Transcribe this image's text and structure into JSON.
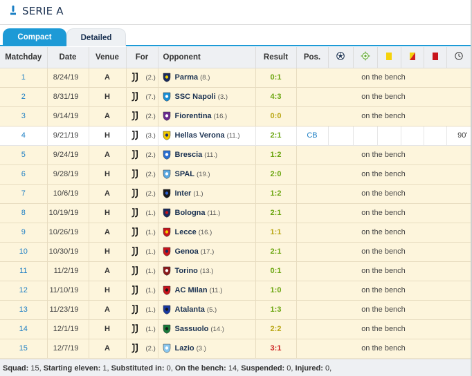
{
  "competition": {
    "title": "SERIE A",
    "icon": "serie-a-icon"
  },
  "tabs": [
    {
      "label": "Compact",
      "active": true
    },
    {
      "label": "Detailed",
      "active": false
    }
  ],
  "columns": {
    "matchday": "Matchday",
    "date": "Date",
    "venue": "Venue",
    "for": "For",
    "opponent": "Opponent",
    "result": "Result",
    "pos": "Pos.",
    "icons": [
      "goals-icon",
      "assists-icon",
      "yellow-card-icon",
      "yellow-red-card-icon",
      "red-card-icon",
      "minutes-clock-icon"
    ]
  },
  "colors": {
    "accent": "#1d9ad6",
    "win": "#6aa50f",
    "draw": "#b9a613",
    "loss": "#cc1e1e",
    "bench_row": "#fdf5dc"
  },
  "rows": [
    {
      "md": "1",
      "date": "8/24/19",
      "venue": "A",
      "for_rank": "(2.)",
      "opp": "Parma",
      "opp_rank": "(8.)",
      "result": "0:1",
      "outcome": "win",
      "status": "on the bench",
      "logo": "parma-logo"
    },
    {
      "md": "2",
      "date": "8/31/19",
      "venue": "H",
      "for_rank": "(7.)",
      "opp": "SSC Napoli",
      "opp_rank": "(3.)",
      "result": "4:3",
      "outcome": "win",
      "status": "on the bench",
      "logo": "napoli-logo"
    },
    {
      "md": "3",
      "date": "9/14/19",
      "venue": "A",
      "for_rank": "(2.)",
      "opp": "Fiorentina",
      "opp_rank": "(16.)",
      "result": "0:0",
      "outcome": "draw",
      "status": "on the bench",
      "logo": "fiorentina-logo"
    },
    {
      "md": "4",
      "date": "9/21/19",
      "venue": "H",
      "for_rank": "(3.)",
      "opp": "Hellas Verona",
      "opp_rank": "(11.)",
      "result": "2:1",
      "outcome": "win",
      "pos": "CB",
      "minutes": "90'",
      "logo": "verona-logo"
    },
    {
      "md": "5",
      "date": "9/24/19",
      "venue": "A",
      "for_rank": "(2.)",
      "opp": "Brescia",
      "opp_rank": "(11.)",
      "result": "1:2",
      "outcome": "win",
      "status": "on the bench",
      "logo": "brescia-logo"
    },
    {
      "md": "6",
      "date": "9/28/19",
      "venue": "H",
      "for_rank": "(2.)",
      "opp": "SPAL",
      "opp_rank": "(19.)",
      "result": "2:0",
      "outcome": "win",
      "status": "on the bench",
      "logo": "spal-logo"
    },
    {
      "md": "7",
      "date": "10/6/19",
      "venue": "A",
      "for_rank": "(2.)",
      "opp": "Inter",
      "opp_rank": "(1.)",
      "result": "1:2",
      "outcome": "win",
      "status": "on the bench",
      "logo": "inter-logo"
    },
    {
      "md": "8",
      "date": "10/19/19",
      "venue": "H",
      "for_rank": "(1.)",
      "opp": "Bologna",
      "opp_rank": "(11.)",
      "result": "2:1",
      "outcome": "win",
      "status": "on the bench",
      "logo": "bologna-logo"
    },
    {
      "md": "9",
      "date": "10/26/19",
      "venue": "A",
      "for_rank": "(1.)",
      "opp": "Lecce",
      "opp_rank": "(16.)",
      "result": "1:1",
      "outcome": "draw",
      "status": "on the bench",
      "logo": "lecce-logo"
    },
    {
      "md": "10",
      "date": "10/30/19",
      "venue": "H",
      "for_rank": "(1.)",
      "opp": "Genoa",
      "opp_rank": "(17.)",
      "result": "2:1",
      "outcome": "win",
      "status": "on the bench",
      "logo": "genoa-logo"
    },
    {
      "md": "11",
      "date": "11/2/19",
      "venue": "A",
      "for_rank": "(1.)",
      "opp": "Torino",
      "opp_rank": "(13.)",
      "result": "0:1",
      "outcome": "win",
      "status": "on the bench",
      "logo": "torino-logo"
    },
    {
      "md": "12",
      "date": "11/10/19",
      "venue": "H",
      "for_rank": "(1.)",
      "opp": "AC Milan",
      "opp_rank": "(11.)",
      "result": "1:0",
      "outcome": "win",
      "status": "on the bench",
      "logo": "milan-logo"
    },
    {
      "md": "13",
      "date": "11/23/19",
      "venue": "A",
      "for_rank": "(1.)",
      "opp": "Atalanta",
      "opp_rank": "(5.)",
      "result": "1:3",
      "outcome": "win",
      "status": "on the bench",
      "logo": "atalanta-logo"
    },
    {
      "md": "14",
      "date": "12/1/19",
      "venue": "H",
      "for_rank": "(1.)",
      "opp": "Sassuolo",
      "opp_rank": "(14.)",
      "result": "2:2",
      "outcome": "draw",
      "status": "on the bench",
      "logo": "sassuolo-logo"
    },
    {
      "md": "15",
      "date": "12/7/19",
      "venue": "A",
      "for_rank": "(2.)",
      "opp": "Lazio",
      "opp_rank": "(3.)",
      "result": "3:1",
      "outcome": "loss",
      "status": "on the bench",
      "logo": "lazio-logo"
    }
  ],
  "summary": {
    "squad_label": "Squad:",
    "squad": "15",
    "starting_label": "Starting eleven:",
    "starting": "1",
    "sub_label": "Substituted in:",
    "sub": "0",
    "bench_label": "On the bench:",
    "bench": "14",
    "susp_label": "Suspended:",
    "susp": "0",
    "inj_label": "Injured:",
    "inj": "0"
  }
}
